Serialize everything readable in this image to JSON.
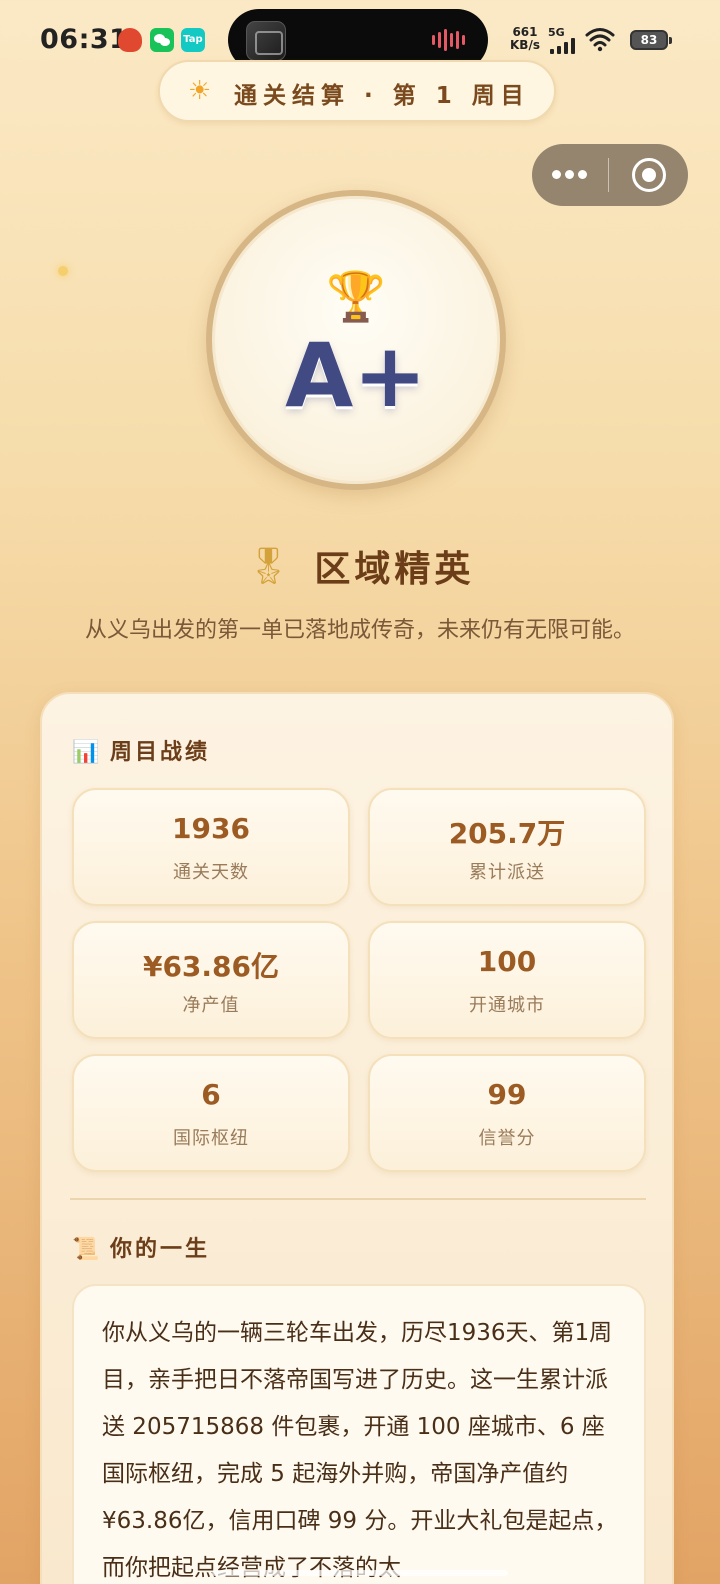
{
  "status_bar": {
    "time": "06:31",
    "net_speed": "661",
    "net_unit": "KB/s",
    "network_type": "5G",
    "battery": "83",
    "tap_label": "Tap"
  },
  "banner": {
    "icon": "sun-icon",
    "text": "通关结算 · 第 1 周目"
  },
  "capsule": {
    "more_icon": "more-dots-icon",
    "close_icon": "close-target-icon"
  },
  "medal": {
    "icon": "trophy-icon",
    "grade": "A+"
  },
  "title": {
    "icon": "medal-icon",
    "text": "区域精英"
  },
  "subtitle": "从义乌出发的第一单已落地成传奇，未来仍有无限可能。",
  "stats_section": {
    "icon": "bar-chart-icon",
    "title": "周目战绩",
    "items": [
      {
        "value": "1936",
        "label": "通关天数"
      },
      {
        "value": "205.7万",
        "label": "累计派送"
      },
      {
        "value": "¥63.86亿",
        "label": "净产值"
      },
      {
        "value": "100",
        "label": "开通城市"
      },
      {
        "value": "6",
        "label": "国际枢纽"
      },
      {
        "value": "99",
        "label": "信誉分"
      }
    ]
  },
  "life_section": {
    "icon": "scroll-icon",
    "title": "你的一生",
    "text": "你从义乌的一辆三轮车出发，历尽1936天、第1周目，亲手把日不落帝国写进了历史。这一生累计派送 205715868 件包裹，开通 100 座城市、6 座国际枢纽，完成 5 起海外并购，帝国净产值约 ¥63.86亿，信用口碑 99 分。开业大礼包是起点，而你把起点经营成了不落的太"
  },
  "colors": {
    "accent": "#9c5b22",
    "grade": "#414a82",
    "heading": "#6b3d18"
  }
}
